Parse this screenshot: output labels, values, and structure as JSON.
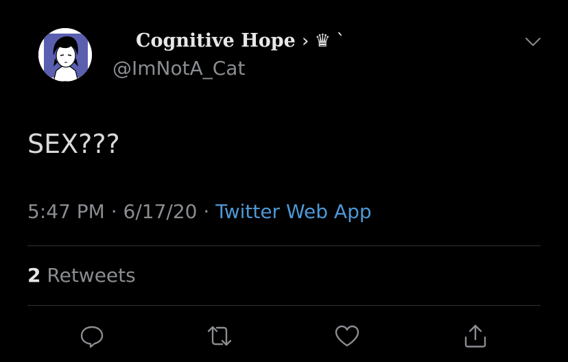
{
  "tweet": {
    "author": {
      "display_name": "Cognitive Hope",
      "name_suffix": "› ♛ `",
      "handle": "@ImNotA_Cat",
      "avatar_icon": "profile-avatar"
    },
    "text": "SEX???",
    "time": "5:47 PM",
    "date": "6/17/20",
    "separator": "·",
    "source": "Twitter Web App",
    "retweet_count": "2",
    "retweet_label": "Retweets"
  },
  "actions": [
    {
      "name": "reply",
      "icon": "comment-icon"
    },
    {
      "name": "retweet",
      "icon": "retweet-icon"
    },
    {
      "name": "like",
      "icon": "heart-icon"
    },
    {
      "name": "share",
      "icon": "share-icon"
    }
  ],
  "colors": {
    "background": "#000000",
    "text": "#d9d9d9",
    "secondary": "#8a8d91",
    "link": "#4e98d7",
    "divider": "#2f3336",
    "avatar_bg": "#5a5fb0"
  }
}
